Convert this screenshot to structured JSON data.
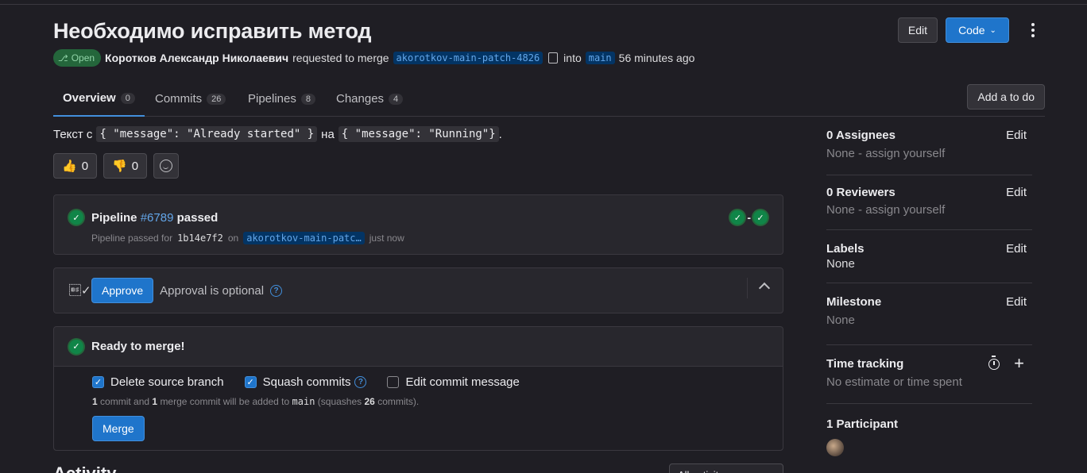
{
  "header": {
    "title": "Необходимо исправить метод",
    "edit_label": "Edit",
    "code_label": "Code",
    "status": "Open",
    "author": "Коротков Александр Николаевич",
    "requested_text": "requested to merge",
    "source_branch": "akorotkov-main-patch-4826",
    "into_text": "into",
    "target_branch": "main",
    "time_ago": "56 minutes ago"
  },
  "tabs": [
    {
      "label": "Overview",
      "count": "0"
    },
    {
      "label": "Commits",
      "count": "26"
    },
    {
      "label": "Pipelines",
      "count": "8"
    },
    {
      "label": "Changes",
      "count": "4"
    }
  ],
  "todo_label": "Add a to do",
  "description": {
    "prefix": "Текст с",
    "code_from": "{ \"message\": \"Already started\" }",
    "middle": "на",
    "code_to": "{ \"message\": \"Running\"}",
    "suffix": "."
  },
  "reactions": {
    "thumbs_up": "0",
    "thumbs_down": "0"
  },
  "pipeline": {
    "label": "Pipeline",
    "id": "#6789",
    "status": "passed",
    "passed_for": "Pipeline passed for",
    "sha": "1b14e7f2",
    "on": "on",
    "branch": "akorotkov-main-patc…",
    "when": "just now"
  },
  "approval": {
    "approve_label": "Approve",
    "optional_text": "Approval is optional"
  },
  "merge": {
    "title": "Ready to merge!",
    "delete_source": "Delete source branch",
    "squash": "Squash commits",
    "edit_message": "Edit commit message",
    "note_n1": "1",
    "note_t1": "commit and",
    "note_n2": "1",
    "note_t2": "merge commit will be added to",
    "note_branch": "main",
    "note_t3": "(squashes",
    "note_n3": "26",
    "note_t4": "commits).",
    "merge_label": "Merge"
  },
  "activity": {
    "title": "Activity",
    "filter": "All activity"
  },
  "sidebar": {
    "assignees": {
      "title": "0 Assignees",
      "value": "None - assign yourself",
      "edit": "Edit"
    },
    "reviewers": {
      "title": "0 Reviewers",
      "value": "None - assign yourself",
      "edit": "Edit"
    },
    "labels": {
      "title": "Labels",
      "value": "None",
      "edit": "Edit"
    },
    "milestone": {
      "title": "Milestone",
      "value": "None",
      "edit": "Edit"
    },
    "time_tracking": {
      "title": "Time tracking",
      "value": "No estimate or time spent"
    },
    "participants": {
      "title": "1 Participant"
    }
  },
  "colors": {
    "accent": "#1f75cb",
    "success": "#108548",
    "background": "#1f1e24"
  }
}
